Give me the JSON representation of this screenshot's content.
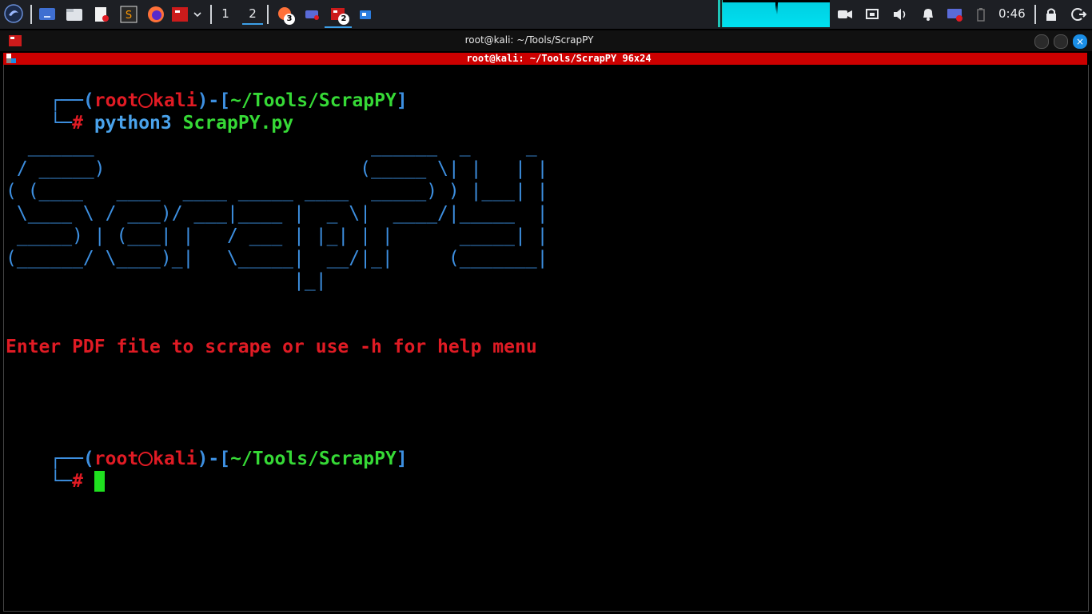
{
  "panel": {
    "workspaces": [
      "1",
      "2"
    ],
    "badges": [
      "3",
      "2"
    ],
    "clock": "0:46"
  },
  "window": {
    "title": "root@kali: ~/Tools/ScrapPY",
    "tab_title": "root@kali: ~/Tools/ScrapPY 96x24"
  },
  "terminal": {
    "prompt1": {
      "open": "┌──(",
      "user": "root",
      "host": "kali",
      "mid": ")-[",
      "path": "~/Tools/ScrapPY",
      "close": "]",
      "hash_prefix": "└─",
      "hash": "#",
      "cmd": "python3",
      "arg": "ScrapPY.py"
    },
    "ascii_banner": [
      "  ______                         ______  _     _",
      " / _____)                       (_____ \\| |   | |",
      "( (____   ____  ____ _____ ____  _____) ) |___| |",
      " \\____ \\ / ___)/ ___|____ |  _ \\|  ____/|_____  |",
      " _____) | (___| |   / ___ | |_| | |      _____| |",
      "(______/ \\____)_|   \\_____|  __/|_|     (_______|",
      "                          |_|"
    ],
    "message": "Enter PDF file to scrape or use -h for help menu",
    "prompt2": {
      "open": "┌──(",
      "user": "root",
      "host": "kali",
      "mid": ")-[",
      "path": "~/Tools/ScrapPY",
      "close": "]",
      "hash_prefix": "└─",
      "hash": "#"
    }
  }
}
